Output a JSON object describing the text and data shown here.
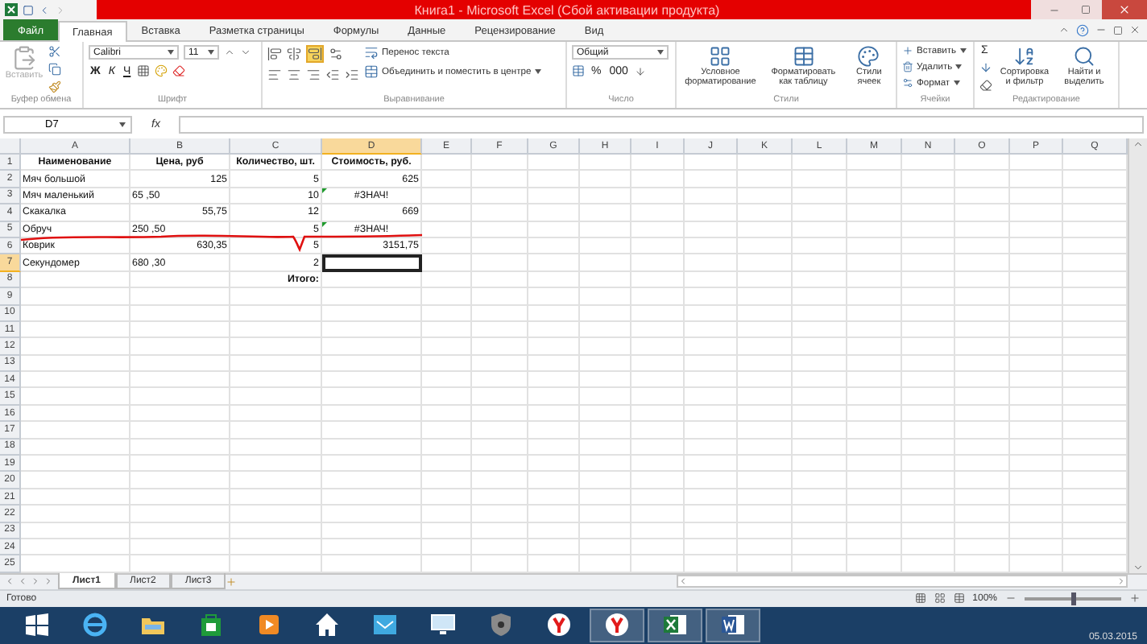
{
  "window": {
    "title": "Книга1 - Microsoft Excel (Сбой активации продукта)"
  },
  "ribbon_tabs": [
    {
      "label": "Файл",
      "kind": "file",
      "selected": false
    },
    {
      "label": "Главная",
      "kind": "tab",
      "selected": true
    },
    {
      "label": "Вставка",
      "kind": "tab",
      "selected": false
    },
    {
      "label": "Разметка страницы",
      "kind": "tab",
      "selected": false
    },
    {
      "label": "Формулы",
      "kind": "tab",
      "selected": false
    },
    {
      "label": "Данные",
      "kind": "tab",
      "selected": false
    },
    {
      "label": "Рецензирование",
      "kind": "tab",
      "selected": false
    },
    {
      "label": "Вид",
      "kind": "tab",
      "selected": false
    }
  ],
  "ribbon": {
    "clipboard": {
      "paste": "Вставить",
      "label": "Буфер обмена"
    },
    "font": {
      "name": "Calibri",
      "size": "11",
      "bold": "Ж",
      "italic": "К",
      "underline": "Ч",
      "label": "Шрифт"
    },
    "alignment": {
      "wrap": "Перенос текста",
      "merge": "Объединить и поместить в центре",
      "label": "Выравнивание"
    },
    "number": {
      "format": "Общий",
      "percent": "%",
      "thousands": "000",
      "label": "Число"
    },
    "styles": {
      "items": [
        "Условное форматирование",
        "Форматировать как таблицу",
        "Стили ячеек"
      ],
      "label": "Стили"
    },
    "cells": {
      "items": [
        "Вставить",
        "Удалить",
        "Формат"
      ],
      "label": "Ячейки"
    },
    "editing": {
      "sum": "Σ",
      "items": [
        "Сортировка и фильтр",
        "Найти и выделить"
      ],
      "label": "Редактирование"
    }
  },
  "formula_bar": {
    "name_box": "D7",
    "fx": "fx"
  },
  "sheet": {
    "columns": [
      {
        "label": "A",
        "selected": false
      },
      {
        "label": "B",
        "selected": false
      },
      {
        "label": "C",
        "selected": false
      },
      {
        "label": "D",
        "selected": true
      },
      {
        "label": "E",
        "selected": false
      },
      {
        "label": "F",
        "selected": false
      },
      {
        "label": "G",
        "selected": false
      },
      {
        "label": "H",
        "selected": false
      },
      {
        "label": "I",
        "selected": false
      },
      {
        "label": "J",
        "selected": false
      },
      {
        "label": "K",
        "selected": false
      },
      {
        "label": "L",
        "selected": false
      },
      {
        "label": "M",
        "selected": false
      },
      {
        "label": "N",
        "selected": false
      },
      {
        "label": "O",
        "selected": false
      },
      {
        "label": "P",
        "selected": false
      },
      {
        "label": "Q",
        "selected": false
      }
    ],
    "rows": [
      {
        "number": "1",
        "selected": false,
        "error_flag": false,
        "cells": [
          {
            "text": "Наименование",
            "kind": "header"
          },
          {
            "text": "Цена, руб",
            "kind": "header"
          },
          {
            "text": "Количество, шт.",
            "kind": "header"
          },
          {
            "text": "Стоимость, руб.",
            "kind": "header"
          }
        ]
      },
      {
        "number": "2",
        "selected": false,
        "error_flag": false,
        "cells": [
          {
            "text": "Мяч большой",
            "kind": "text"
          },
          {
            "text": "125",
            "kind": "number"
          },
          {
            "text": "5",
            "kind": "number"
          },
          {
            "text": "625",
            "kind": "number"
          }
        ]
      },
      {
        "number": "3",
        "selected": false,
        "error_flag": true,
        "cells": [
          {
            "text": "Мяч маленький",
            "kind": "text"
          },
          {
            "text": "65 ,50",
            "kind": "text"
          },
          {
            "text": "10",
            "kind": "number"
          },
          {
            "text": "#ЗНАЧ!",
            "kind": "error"
          }
        ]
      },
      {
        "number": "4",
        "selected": false,
        "error_flag": false,
        "cells": [
          {
            "text": "Скакалка",
            "kind": "text"
          },
          {
            "text": "55,75",
            "kind": "number"
          },
          {
            "text": "12",
            "kind": "number"
          },
          {
            "text": "669",
            "kind": "number"
          }
        ]
      },
      {
        "number": "5",
        "selected": false,
        "error_flag": true,
        "cells": [
          {
            "text": "Обруч",
            "kind": "text"
          },
          {
            "text": "250 ,50",
            "kind": "text"
          },
          {
            "text": "5",
            "kind": "number"
          },
          {
            "text": "#ЗНАЧ!",
            "kind": "error"
          }
        ]
      },
      {
        "number": "6",
        "selected": false,
        "error_flag": false,
        "cells": [
          {
            "text": "Коврик",
            "kind": "text"
          },
          {
            "text": "630,35",
            "kind": "number"
          },
          {
            "text": "5",
            "kind": "number"
          },
          {
            "text": "3151,75",
            "kind": "number"
          }
        ]
      },
      {
        "number": "7",
        "selected": true,
        "error_flag": false,
        "cells": [
          {
            "text": "Секундомер",
            "kind": "text"
          },
          {
            "text": "680 ,30",
            "kind": "text"
          },
          {
            "text": "2",
            "kind": "number"
          },
          null
        ]
      },
      {
        "number": "8",
        "selected": false,
        "error_flag": false,
        "cells": [
          null,
          null,
          {
            "text": "Итого:",
            "kind": "total"
          }
        ]
      },
      {
        "number": "9",
        "selected": false,
        "error_flag": false,
        "cells": []
      },
      {
        "number": "10",
        "selected": false,
        "error_flag": false,
        "cells": []
      },
      {
        "number": "11",
        "selected": false,
        "error_flag": false,
        "cells": []
      },
      {
        "number": "12",
        "selected": false,
        "error_flag": false,
        "cells": []
      },
      {
        "number": "13",
        "selected": false,
        "error_flag": false,
        "cells": []
      },
      {
        "number": "14",
        "selected": false,
        "error_flag": false,
        "cells": []
      },
      {
        "number": "15",
        "selected": false,
        "error_flag": false,
        "cells": []
      },
      {
        "number": "16",
        "selected": false,
        "error_flag": false,
        "cells": []
      },
      {
        "number": "17",
        "selected": false,
        "error_flag": false,
        "cells": []
      },
      {
        "number": "18",
        "selected": false,
        "error_flag": false,
        "cells": []
      },
      {
        "number": "19",
        "selected": false,
        "error_flag": false,
        "cells": []
      },
      {
        "number": "20",
        "selected": false,
        "error_flag": false,
        "cells": []
      },
      {
        "number": "21",
        "selected": false,
        "error_flag": false,
        "cells": []
      },
      {
        "number": "22",
        "selected": false,
        "error_flag": false,
        "cells": []
      },
      {
        "number": "23",
        "selected": false,
        "error_flag": false,
        "cells": []
      },
      {
        "number": "24",
        "selected": false,
        "error_flag": false,
        "cells": []
      },
      {
        "number": "25",
        "selected": false,
        "error_flag": false,
        "cells": []
      }
    ]
  },
  "sheet_tabs": [
    {
      "label": "Лист1",
      "selected": true
    },
    {
      "label": "Лист2",
      "selected": false
    },
    {
      "label": "Лист3",
      "selected": false
    }
  ],
  "status_bar": {
    "status": "Готово",
    "zoom": {
      "reading": "100%",
      "level": 0.5
    }
  },
  "taskbar": {
    "apps": [
      {
        "kind": "windows",
        "running": false
      },
      {
        "kind": "browser",
        "running": false
      },
      {
        "kind": "folder",
        "running": false
      },
      {
        "kind": "store",
        "running": false
      },
      {
        "kind": "media",
        "running": false
      },
      {
        "kind": "home",
        "running": false
      },
      {
        "kind": "mail",
        "running": false
      },
      {
        "kind": "monitor",
        "running": false
      },
      {
        "kind": "shield",
        "running": false
      },
      {
        "kind": "yandex",
        "running": false
      },
      {
        "kind": "yandex",
        "running": true
      },
      {
        "kind": "excel",
        "running": true
      },
      {
        "kind": "word",
        "running": true
      }
    ],
    "clock": "05.03.2015"
  }
}
